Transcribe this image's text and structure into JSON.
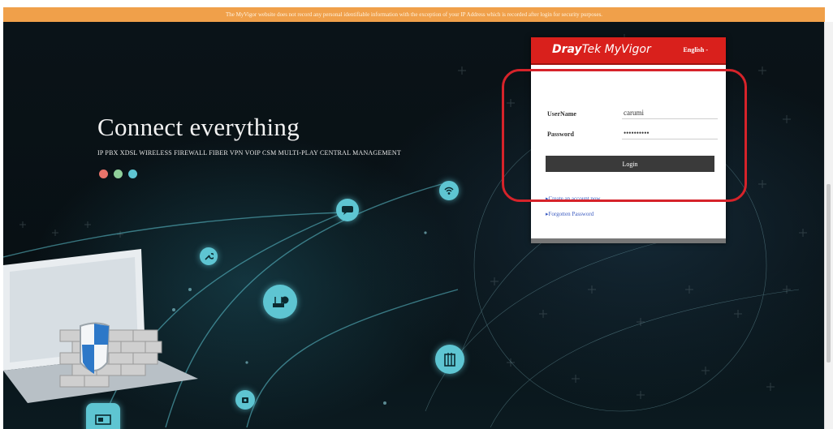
{
  "notice": "The MyVigor website does not record any personal identifiable information with the exception of your IP Address which is recorded after login for security purposes.",
  "hero": {
    "title": "Connect everything",
    "subtitle": "IP PBX XDSL WIRELESS FIREWALL FIBER VPN VOIP CSM MULTI-PLAY CENTRAL MANAGEMENT",
    "dot_colors": [
      "#e8736a",
      "#8fcf9a",
      "#5ec5d2"
    ]
  },
  "login": {
    "brand_bold": "Dray",
    "brand_rest": "Tek MyVigor",
    "language": "English -",
    "username_label": "UserName",
    "username_value": "carumi",
    "password_label": "Password",
    "password_value": "••••••••••",
    "login_button": "Login",
    "create_account": "▸Create an account now",
    "forgotten_password": "▸Forgotten Password"
  },
  "colors": {
    "brand_red": "#d9201c",
    "accent_teal": "#5ec5d2",
    "notice_orange": "#f0a04a",
    "highlight_red": "#d6232a"
  },
  "icons": [
    "wifi-icon",
    "sms-icon",
    "wrench-icon",
    "router-icon",
    "building-icon",
    "phone-icon",
    "monitor-icon",
    "shield-icon"
  ]
}
